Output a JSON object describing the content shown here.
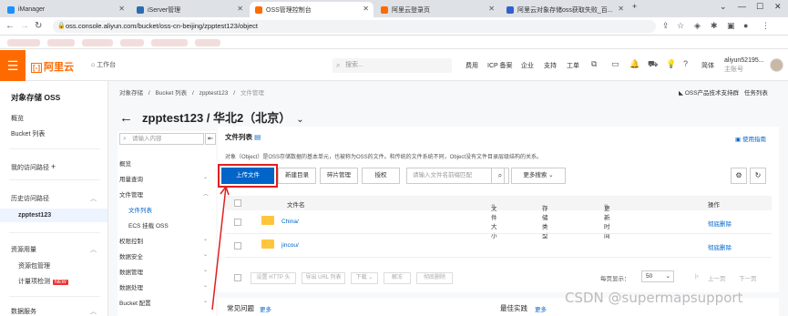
{
  "browser": {
    "tabs": [
      {
        "label": "iManager",
        "color": "#1890ff"
      },
      {
        "label": "iServer管理",
        "color": "#2b6cb0"
      },
      {
        "label": "OSS管理控制台",
        "color": "#ff6a00"
      },
      {
        "label": "阿里云登录页",
        "color": "#ff6a00"
      },
      {
        "label": "阿里云对象存储oss获取失败_百...",
        "color": "#3060d0"
      }
    ],
    "url": "oss.console.aliyun.com/bucket/oss-cn-beijing/zpptest123/object"
  },
  "topnav": {
    "logo": "阿里云",
    "workbench": "工作台",
    "search_placeholder": "搜索...",
    "links": [
      "费用",
      "ICP 备案",
      "企业",
      "支持",
      "工单"
    ],
    "lang": "简体",
    "user_name": "aliyun52195...",
    "user_role": "主账号"
  },
  "sidebar": {
    "title": "对象存储 OSS",
    "items": [
      "概览",
      "Bucket 列表"
    ],
    "group_dev": "我的访问路径",
    "recent_label": "历史访问路径",
    "recent_item": "zpptest123",
    "resource_label": "资源用量",
    "resource_items": [
      "资源包管理",
      "计量项检测"
    ],
    "new_badge": "NEW",
    "data_service": "数据服务"
  },
  "main": {
    "breadcrumb": [
      "对象存储",
      "/",
      "Bucket 列表",
      "/",
      "zpptest123",
      "/",
      "文件管理"
    ],
    "right_links": [
      "OSS产品技术支持群",
      "任务列表"
    ],
    "title": "zpptest123 / 华北2（北京）"
  },
  "subnav": {
    "search_placeholder": "请输入内容",
    "items": [
      {
        "label": "概览",
        "type": "top"
      },
      {
        "label": "用量查询",
        "type": "group"
      },
      {
        "label": "文件管理",
        "type": "group"
      },
      {
        "label": "文件列表",
        "type": "sub",
        "selected": true
      },
      {
        "label": "ECS 挂载 OSS",
        "type": "sub"
      },
      {
        "label": "权限控制",
        "type": "group"
      },
      {
        "label": "数据安全",
        "type": "group"
      },
      {
        "label": "数据管理",
        "type": "group"
      },
      {
        "label": "数据处理",
        "type": "group"
      },
      {
        "label": "Bucket 配置",
        "type": "group"
      }
    ]
  },
  "files": {
    "title": "文件列表",
    "guide": "使用指南",
    "description": "对象（Object）是OSS存储数据的基本单元，也被称为OSS的文件。和传统的文件系统不同，Object没有文件目录层级结构的关系。",
    "buttons": [
      "上传文件",
      "新建目录",
      "碎片管理",
      "授权"
    ],
    "search_placeholder": "请输入文件名前缀匹配",
    "more_search": "更多搜索",
    "columns": [
      "文件名",
      "文件大小",
      "存储类型",
      "更新时间",
      "操作"
    ],
    "rows": [
      {
        "name": "China/",
        "op": "彻底删除"
      },
      {
        "name": "jincou/",
        "op": "彻底删除"
      }
    ],
    "bulk_buttons": [
      "设置 HTTP 头",
      "导出 URL 列表",
      "下载",
      "解冻",
      "彻底删除"
    ],
    "page_size_label": "每页显示：",
    "page_size": "50",
    "prev": "上一页",
    "next": "下一页",
    "faq": "常见问题",
    "faq_more": "更多",
    "best": "最佳实践",
    "best_more": "更多"
  },
  "watermark": "CSDN @supermapsupport"
}
